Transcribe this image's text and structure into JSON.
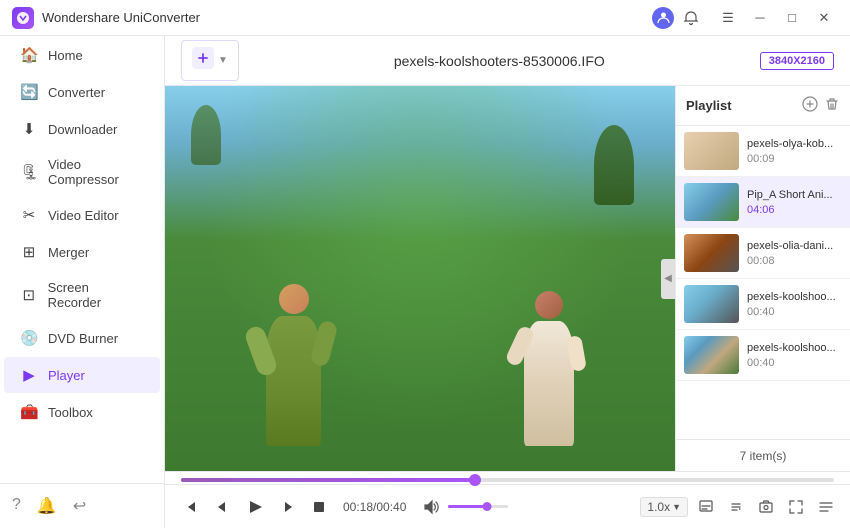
{
  "titlebar": {
    "app_name": "Wondershare UniConverter",
    "logo_text": "W"
  },
  "sidebar": {
    "items": [
      {
        "id": "home",
        "label": "Home",
        "icon": "🏠"
      },
      {
        "id": "converter",
        "label": "Converter",
        "icon": "🔄"
      },
      {
        "id": "downloader",
        "label": "Downloader",
        "icon": "⬇"
      },
      {
        "id": "video-compressor",
        "label": "Video Compressor",
        "icon": "🗜"
      },
      {
        "id": "video-editor",
        "label": "Video Editor",
        "icon": "✂"
      },
      {
        "id": "merger",
        "label": "Merger",
        "icon": "⊞"
      },
      {
        "id": "screen-recorder",
        "label": "Screen Recorder",
        "icon": "⊡"
      },
      {
        "id": "dvd-burner",
        "label": "DVD Burner",
        "icon": "💿"
      },
      {
        "id": "player",
        "label": "Player",
        "icon": "▶",
        "active": true
      },
      {
        "id": "toolbox",
        "label": "Toolbox",
        "icon": "🧰"
      }
    ],
    "footer": [
      {
        "id": "help",
        "icon": "?"
      },
      {
        "id": "notifications",
        "icon": "🔔"
      },
      {
        "id": "feedback",
        "icon": "↩"
      }
    ]
  },
  "player": {
    "add_label": "",
    "file_title": "pexels-koolshooters-8530006.IFO",
    "resolution": "3840X2160",
    "current_time": "00:18/00:40",
    "progress_percent": 45,
    "volume_percent": 65,
    "speed": "1.0x"
  },
  "playlist": {
    "title": "Playlist",
    "item_count": "7 item(s)",
    "items": [
      {
        "id": 1,
        "name": "pexels-olya-kob...",
        "duration": "00:09",
        "active": false,
        "thumb_class": "thumb-1"
      },
      {
        "id": 2,
        "name": "Pip_A Short Ani...",
        "duration": "04:06",
        "active": true,
        "thumb_class": "thumb-2"
      },
      {
        "id": 3,
        "name": "pexels-olia-dani...",
        "duration": "00:08",
        "active": false,
        "thumb_class": "thumb-3"
      },
      {
        "id": 4,
        "name": "pexels-koolshoo...",
        "duration": "00:40",
        "active": false,
        "thumb_class": "thumb-4"
      },
      {
        "id": 5,
        "name": "pexels-koolshoo...",
        "duration": "00:40",
        "active": false,
        "thumb_class": "thumb-5"
      }
    ]
  },
  "controls": {
    "rewind": "⏮",
    "prev": "◀",
    "play": "▶",
    "next": "▶",
    "stop": "■",
    "volume_icon": "🔊"
  }
}
